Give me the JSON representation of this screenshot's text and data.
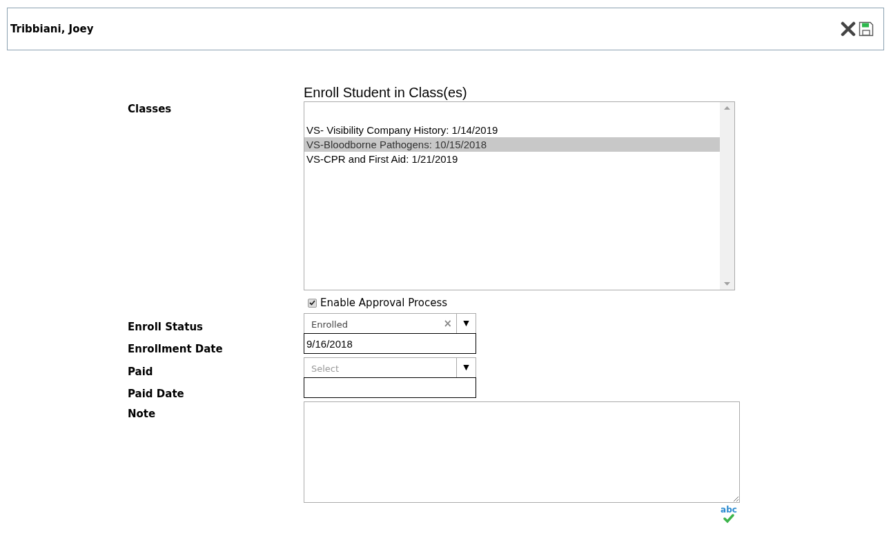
{
  "header": {
    "title": "Tribbiani, Joey"
  },
  "form_title": "Enroll Student in Class(es)",
  "classes": {
    "label": "Classes",
    "options": [
      {
        "text": "VS- Visibility Company History: 1/14/2019",
        "selected": false
      },
      {
        "text": "VS-Bloodborne Pathogens: 10/15/2018",
        "selected": true
      },
      {
        "text": "VS-CPR and First Aid: 1/21/2019",
        "selected": false
      }
    ]
  },
  "approval": {
    "label": "Enable Approval Process",
    "checked": true
  },
  "enroll_status": {
    "label": "Enroll Status",
    "value": "Enrolled",
    "clear": "×",
    "caret": "▼"
  },
  "enrollment_date": {
    "label": "Enrollment Date",
    "value": "9/16/2018"
  },
  "paid": {
    "label": "Paid",
    "placeholder": "Select",
    "caret": "▼"
  },
  "paid_date": {
    "label": "Paid Date"
  },
  "note": {
    "label": "Note"
  },
  "spellcheck": {
    "text": "abc"
  }
}
